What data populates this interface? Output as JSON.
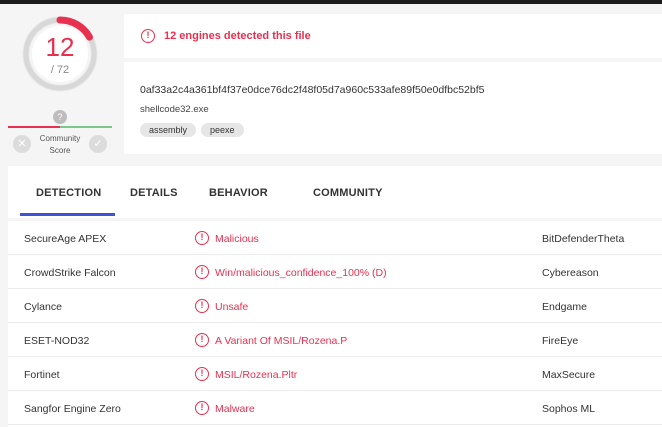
{
  "score": {
    "detected": "12",
    "total": "/ 72",
    "detected_fraction": 0.1667,
    "community_marker": "?",
    "community_label": "Community Score",
    "colors": {
      "accent": "#e8304f",
      "ring": "#d8d8d8"
    }
  },
  "alert": {
    "text": "12 engines detected this file"
  },
  "file": {
    "hash": "0af33a2c4a361bf4f37e0dce76dc2f48f05d7a960c533afe89f50e0dfbc52bf5",
    "name": "shellcode32.exe",
    "tags": [
      "assembly",
      "peexe"
    ]
  },
  "tabs": [
    "DETECTION",
    "DETAILS",
    "BEHAVIOR",
    "COMMUNITY"
  ],
  "rows": [
    {
      "engine": "SecureAge APEX",
      "result": "Malicious",
      "engine2": "BitDefenderTheta"
    },
    {
      "engine": "CrowdStrike Falcon",
      "result": "Win/malicious_confidence_100% (D)",
      "engine2": "Cybereason"
    },
    {
      "engine": "Cylance",
      "result": "Unsafe",
      "engine2": "Endgame"
    },
    {
      "engine": "ESET-NOD32",
      "result": "A Variant Of MSIL/Rozena.P",
      "engine2": "FireEye"
    },
    {
      "engine": "Fortinet",
      "result": "MSIL/Rozena.Pltr",
      "engine2": "MaxSecure"
    },
    {
      "engine": "Sangfor Engine Zero",
      "result": "Malware",
      "engine2": "Sophos ML"
    }
  ],
  "icons": {
    "alert": "alert-circle-icon",
    "thumb_down": "close-icon",
    "thumb_up": "check-icon"
  }
}
